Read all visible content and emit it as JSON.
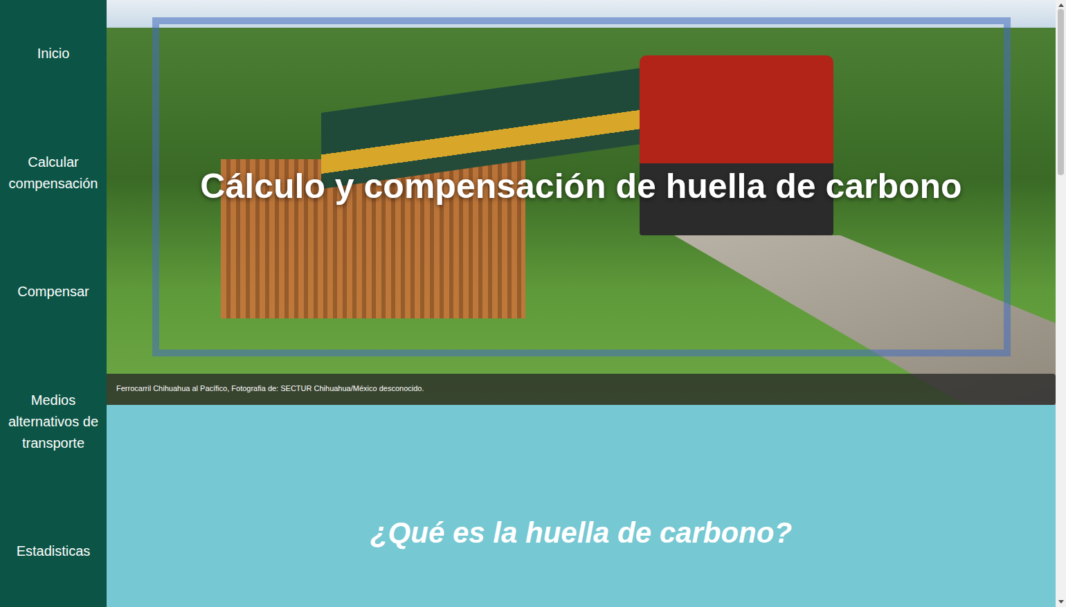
{
  "sidebar": {
    "items": [
      {
        "label": "Inicio"
      },
      {
        "label": "Calcular compensación"
      },
      {
        "label": "Compensar"
      },
      {
        "label": "Medios alternativos de transporte"
      },
      {
        "label": "Estadisticas"
      }
    ]
  },
  "hero": {
    "title": "Cálculo y compensación de huella de carbono",
    "caption": "Ferrocarril Chihuahua al Pacífico, Fotografia de: SECTUR Chihuahua/México desconocido."
  },
  "section": {
    "heading": "¿Qué es la huella de carbono?"
  }
}
